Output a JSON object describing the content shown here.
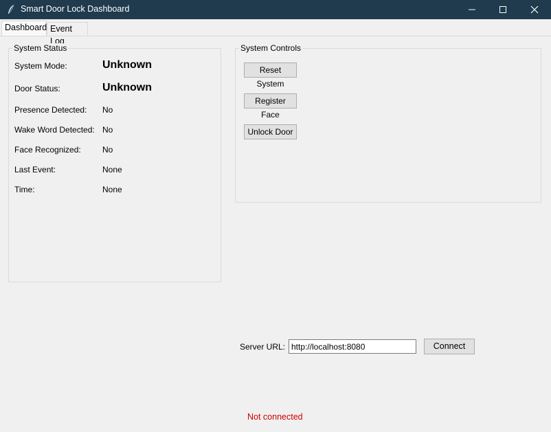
{
  "window": {
    "title": "Smart Door Lock Dashboard",
    "icon": "feather-icon"
  },
  "tabs": [
    {
      "label": "Dashboard",
      "active": true
    },
    {
      "label": "Event Log",
      "active": false
    }
  ],
  "system_status": {
    "heading": "System Status",
    "rows": [
      {
        "label": "System Mode:",
        "value": "Unknown"
      },
      {
        "label": "Door Status:",
        "value": "Unknown"
      },
      {
        "label": "Presence Detected:",
        "value": "No"
      },
      {
        "label": "Wake Word Detected:",
        "value": "No"
      },
      {
        "label": "Face Recognized:",
        "value": "No"
      },
      {
        "label": "Last Event:",
        "value": "None"
      },
      {
        "label": "Time:",
        "value": "None"
      }
    ]
  },
  "system_controls": {
    "heading": "System Controls",
    "buttons": {
      "reset": "Reset System",
      "register": "Register Face",
      "unlock": "Unlock Door"
    }
  },
  "server": {
    "label": "Server URL:",
    "url_value": "http://localhost:8080",
    "connect_label": "Connect"
  },
  "connection": {
    "status": "Not connected",
    "status_color": "#cc0000"
  },
  "colors": {
    "titlebar": "#1f3b4d",
    "window_bg": "#f0f0f0"
  }
}
